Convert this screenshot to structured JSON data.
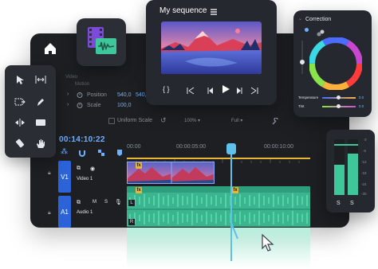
{
  "preview": {
    "title": "My sequence",
    "menu_icon": "hamburger-icon"
  },
  "correction": {
    "title": "Correction",
    "temperature_label": "Temperature",
    "temperature_value": "0.0",
    "tint_label": "Tint",
    "tint_value": "0.0"
  },
  "properties": {
    "header": "Video",
    "subheader": "Motion",
    "position_label": "Position",
    "position_x": "540,0",
    "position_y": "540,0",
    "scale_label": "Scale",
    "scale_value": "100,0",
    "uniform_scale_label": "Uniform Scale",
    "zoom_value": "100%",
    "fit_value": "Full"
  },
  "timeline": {
    "timecode": "00:14:10:22",
    "ruler": [
      "00:00",
      "00:00:05:00",
      "00:00:10:00"
    ],
    "video_track": {
      "tag": "V1",
      "name": "Video 1"
    },
    "audio_track": {
      "tag": "A1",
      "name": "Audio 1",
      "m": "M",
      "s": "S"
    },
    "fx_badge": "fx",
    "clip_l": "L",
    "clip_r": "R"
  },
  "meter": {
    "scale": [
      "0",
      "-6",
      "-12",
      "-18",
      "-24",
      "-30"
    ],
    "left_label": "S",
    "right_label": "S",
    "left_level": 0.55,
    "right_level": 0.75
  },
  "colors": {
    "accent": "#2c63d9",
    "timeline_blue": "#6fb0ff",
    "audio_green": "#3ec79b",
    "playhead": "#5fc0ea",
    "fx_gold": "#e8b63a"
  }
}
